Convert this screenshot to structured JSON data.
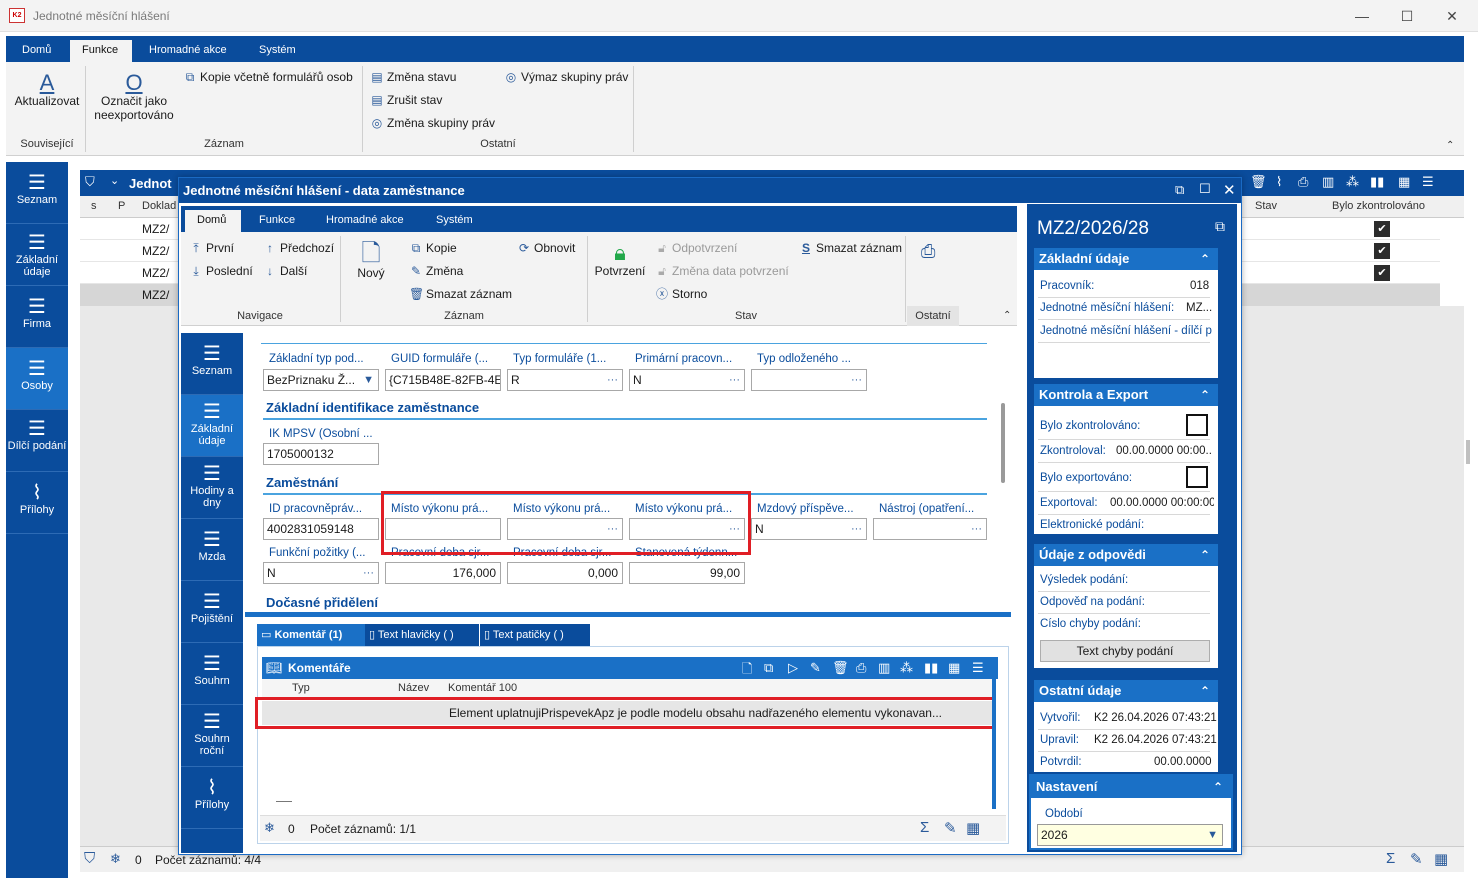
{
  "app": {
    "title": "Jednotné měsíční hlášení",
    "logo_text": "K2",
    "colors": {
      "accent": "#0a4c9c",
      "nav_selected": "#1a70c6",
      "highlight": "#e01e25"
    }
  },
  "ribbon": {
    "tabs": [
      "Domů",
      "Funkce",
      "Hromadné akce",
      "Systém"
    ],
    "active_tab": "Funkce",
    "groups": {
      "souvisejici": {
        "label": "Související",
        "aktualizovat": "Aktualizovat"
      },
      "zaznam": {
        "label": "Záznam",
        "kopie_formularu": "Kopie včetně formulářů osob",
        "oznacit_line1": "Označit jako",
        "oznacit_line2": "neexportováno"
      },
      "ostatni": {
        "label": "Ostatní",
        "zmena_stavu": "Změna stavu",
        "zrusit_stav": "Zrušit stav",
        "zmena_skupiny": "Změna skupiny práv",
        "vymaz_skupiny": "Výmaz skupiny práv"
      }
    }
  },
  "leftnav": [
    {
      "label": "Seznam"
    },
    {
      "label": "Základní údaje"
    },
    {
      "label": "Firma"
    },
    {
      "label": "Osoby"
    },
    {
      "label": "Dílčí podání"
    },
    {
      "label": "Přílohy"
    }
  ],
  "grid": {
    "title": "Jednot",
    "columns": {
      "s": "s",
      "p": "P",
      "doklad": "Doklad",
      "stav": "Stav",
      "zkontrolovano": "Bylo zkontrolováno"
    },
    "rows": [
      {
        "doklad": "MZ2/",
        "checked": true
      },
      {
        "doklad": "MZ2/",
        "checked": true
      },
      {
        "doklad": "MZ2/",
        "checked": true
      },
      {
        "doklad": "MZ2/",
        "checked": false
      }
    ],
    "footer": {
      "count_zero": "0",
      "records": "Počet záznamů: 4/4"
    }
  },
  "modal": {
    "title": "Jednotné měsíční hlášení - data zaměstnance",
    "tabs": [
      "Domů",
      "Funkce",
      "Hromadné akce",
      "Systém"
    ],
    "ribbon": {
      "navigace": {
        "label": "Navigace",
        "prvni": "První",
        "predchozi": "Předchozí",
        "posledni": "Poslední",
        "dalsi": "Další"
      },
      "zaznam": {
        "label": "Záznam",
        "novy": "Nový",
        "kopie": "Kopie",
        "zmena": "Změna",
        "smazat": "Smazat záznam",
        "obnovit": "Obnovit"
      },
      "stav": {
        "label": "Stav",
        "potvrzeni": "Potvrzení",
        "odpotvrzeni": "Odpotvrzení",
        "zmena_data": "Změna data potvrzení",
        "storno": "Storno",
        "smazat_zaznam": "Smazat záznam"
      },
      "ostatni": {
        "label": "Ostatní"
      }
    },
    "nav": [
      {
        "label": "Seznam"
      },
      {
        "label": "Základní údaje"
      },
      {
        "label": "Hodiny a dny"
      },
      {
        "label": "Mzda"
      },
      {
        "label": "Pojištění"
      },
      {
        "label": "Souhrn"
      },
      {
        "label": "Souhrn roční"
      },
      {
        "label": "Přílohy"
      }
    ],
    "form": {
      "row1": [
        {
          "label": "Základní typ pod...",
          "value": "BezPriznaku Ž..."
        },
        {
          "label": "GUID formuláře (...",
          "value": "{C715B48E-82FB-4E"
        },
        {
          "label": "Typ formuláře (1...",
          "value": "R"
        },
        {
          "label": "Primární pracovn...",
          "value": "N"
        },
        {
          "label": "Typ odloženého ...",
          "value": ""
        }
      ],
      "section_ident": "Základní identifikace zaměstnance",
      "ik_label": "IK MPSV (Osobní ...",
      "ik_value": "1705000132",
      "section_zam": "Zaměstnání",
      "row3": [
        {
          "label": "ID pracovněpráv...",
          "value": "4002831059148"
        },
        {
          "label": "Místo výkonu prá...",
          "value": ""
        },
        {
          "label": "Místo výkonu prá...",
          "value": ""
        },
        {
          "label": "Místo výkonu prá...",
          "value": ""
        },
        {
          "label": "Mzdový příspěve...",
          "value": "N"
        },
        {
          "label": "Nástroj (opatření...",
          "value": ""
        }
      ],
      "row4": [
        {
          "label": "Funkční požitky (...",
          "value": "N"
        },
        {
          "label": "Pracovní doba sjr...",
          "value": "176,000"
        },
        {
          "label": "Pracovní doba sjr...",
          "value": "0,000"
        },
        {
          "label": "Stanovená týdenn...",
          "value": "99,00"
        }
      ],
      "section_docasne": "Dočasné přidělení"
    },
    "bottom_tabs": [
      "Komentář (1)",
      "Text hlavičky ( )",
      "Text patičky ( )"
    ],
    "comments": {
      "title": "Komentáře",
      "columns": {
        "typ": "Typ",
        "nazev": "Název",
        "komentar": "Komentář 100"
      },
      "row_text": "Element uplatnujiPrispevekApz je podle modelu obsahu nadřazeného elementu vykonavan...",
      "footer_count": "0",
      "footer_records": "Počet záznamů: 1/1"
    },
    "right": {
      "doc_id": "MZ2/2026/28",
      "zakladni": {
        "title": "Základní údaje",
        "pracovnik_label": "Pracovník:",
        "pracovnik_value": "018",
        "jmh_label": "Jednotné měsíční hlášení:",
        "jmh_value": "MZ...",
        "dilci_label": "Jednotné měsíční hlášení - dílčí p"
      },
      "kontrola": {
        "title": "Kontrola a Export",
        "zkontrolovano": "Bylo zkontrolováno:",
        "zkontroloval_label": "Zkontroloval:",
        "zkontroloval_value": "00.00.0000 00:00...",
        "exportovano": "Bylo exportováno:",
        "exportoval_label": "Exportoval:",
        "exportoval_value": "00.00.0000 00:00:00",
        "elektronicke": "Elektronické podání:"
      },
      "odpoved": {
        "title": "Údaje z odpovědi",
        "vysledek": "Výsledek podání:",
        "odpoved": "Odpověď na podání:",
        "cislo": "Číslo chyby podání:",
        "button": "Text chyby podání"
      },
      "ostatni": {
        "title": "Ostatní údaje",
        "vytvoril_label": "Vytvořil:",
        "vytvoril_value": "K2 26.04.2026 07:43:21",
        "upravil_label": "Upravil:",
        "upravil_value": "K2 26.04.2026 07:43:21",
        "potvrdil_label": "Potvrdil:",
        "potvrdil_value": "00.00.0000"
      },
      "nastaveni": {
        "title": "Nastavení",
        "obdobi_label": "Období",
        "obdobi_value": "2026"
      }
    }
  }
}
